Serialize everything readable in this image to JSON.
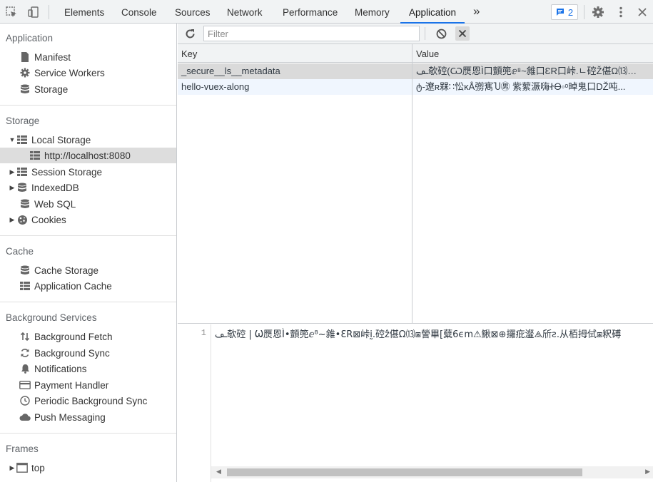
{
  "toolbar": {
    "tabs": [
      "Elements",
      "Console",
      "Sources",
      "Network",
      "Performance",
      "Memory",
      "Application"
    ],
    "active_tab": "Application",
    "more_label": "»",
    "issues_count": "2",
    "accent": "#1a73e8"
  },
  "sidebar": {
    "sections": {
      "application": {
        "title": "Application",
        "items": [
          {
            "label": "Manifest",
            "icon": "file-icon"
          },
          {
            "label": "Service Workers",
            "icon": "gear-icon"
          },
          {
            "label": "Storage",
            "icon": "database-icon"
          }
        ]
      },
      "storage": {
        "title": "Storage",
        "items": [
          {
            "label": "Local Storage",
            "icon": "grid-icon",
            "expanded": true
          },
          {
            "label": "http://localhost:8080",
            "icon": "grid-icon",
            "selected": true
          },
          {
            "label": "Session Storage",
            "icon": "grid-icon"
          },
          {
            "label": "IndexedDB",
            "icon": "database-icon"
          },
          {
            "label": "Web SQL",
            "icon": "database-icon"
          },
          {
            "label": "Cookies",
            "icon": "cookie-icon"
          }
        ]
      },
      "cache": {
        "title": "Cache",
        "items": [
          {
            "label": "Cache Storage",
            "icon": "database-icon"
          },
          {
            "label": "Application Cache",
            "icon": "grid-icon"
          }
        ]
      },
      "background": {
        "title": "Background Services",
        "items": [
          {
            "label": "Background Fetch",
            "icon": "updown-arrows-icon"
          },
          {
            "label": "Background Sync",
            "icon": "sync-icon"
          },
          {
            "label": "Notifications",
            "icon": "bell-icon"
          },
          {
            "label": "Payment Handler",
            "icon": "card-icon"
          },
          {
            "label": "Periodic Background Sync",
            "icon": "clock-icon"
          },
          {
            "label": "Push Messaging",
            "icon": "cloud-icon"
          }
        ]
      },
      "frames": {
        "title": "Frames",
        "items": [
          {
            "label": "top",
            "icon": "frame-icon"
          }
        ]
      }
    }
  },
  "main": {
    "filter_placeholder": "Filter",
    "columns": [
      "Key",
      "Value"
    ],
    "rows": [
      {
        "key": "_secure__ls__metadata",
        "value": "ـڡ欹硿(Ѡ㷳恩Ì口顫篼ⅇ⁸~雓口ƐR口峠.ㄴ硿Ž偡Ω⒀口謍..."
      },
      {
        "key": "hello-vuex-along",
        "value": "ტ-遼ʀ槑∷忪ĸÅ彅寯Ⴎ㊚ 紫蕠㵐嗨ᏐᎾ◦ᵒ晫鬼口DŽ吨..."
      }
    ],
    "preview": {
      "line_number": "1",
      "text": "ـڡ欹硿 | Ѡ㷳恩Ì•顫篼ⅇ⁸~雓•ƐR⊠峠ḭ.硿ẑ偡Ω⒀⧆謍畢[糵6ϵm⚠鰍⊠⊕攞疪瀣⧌斦ƨ.从栢拇侙⧆粎磗"
    }
  }
}
